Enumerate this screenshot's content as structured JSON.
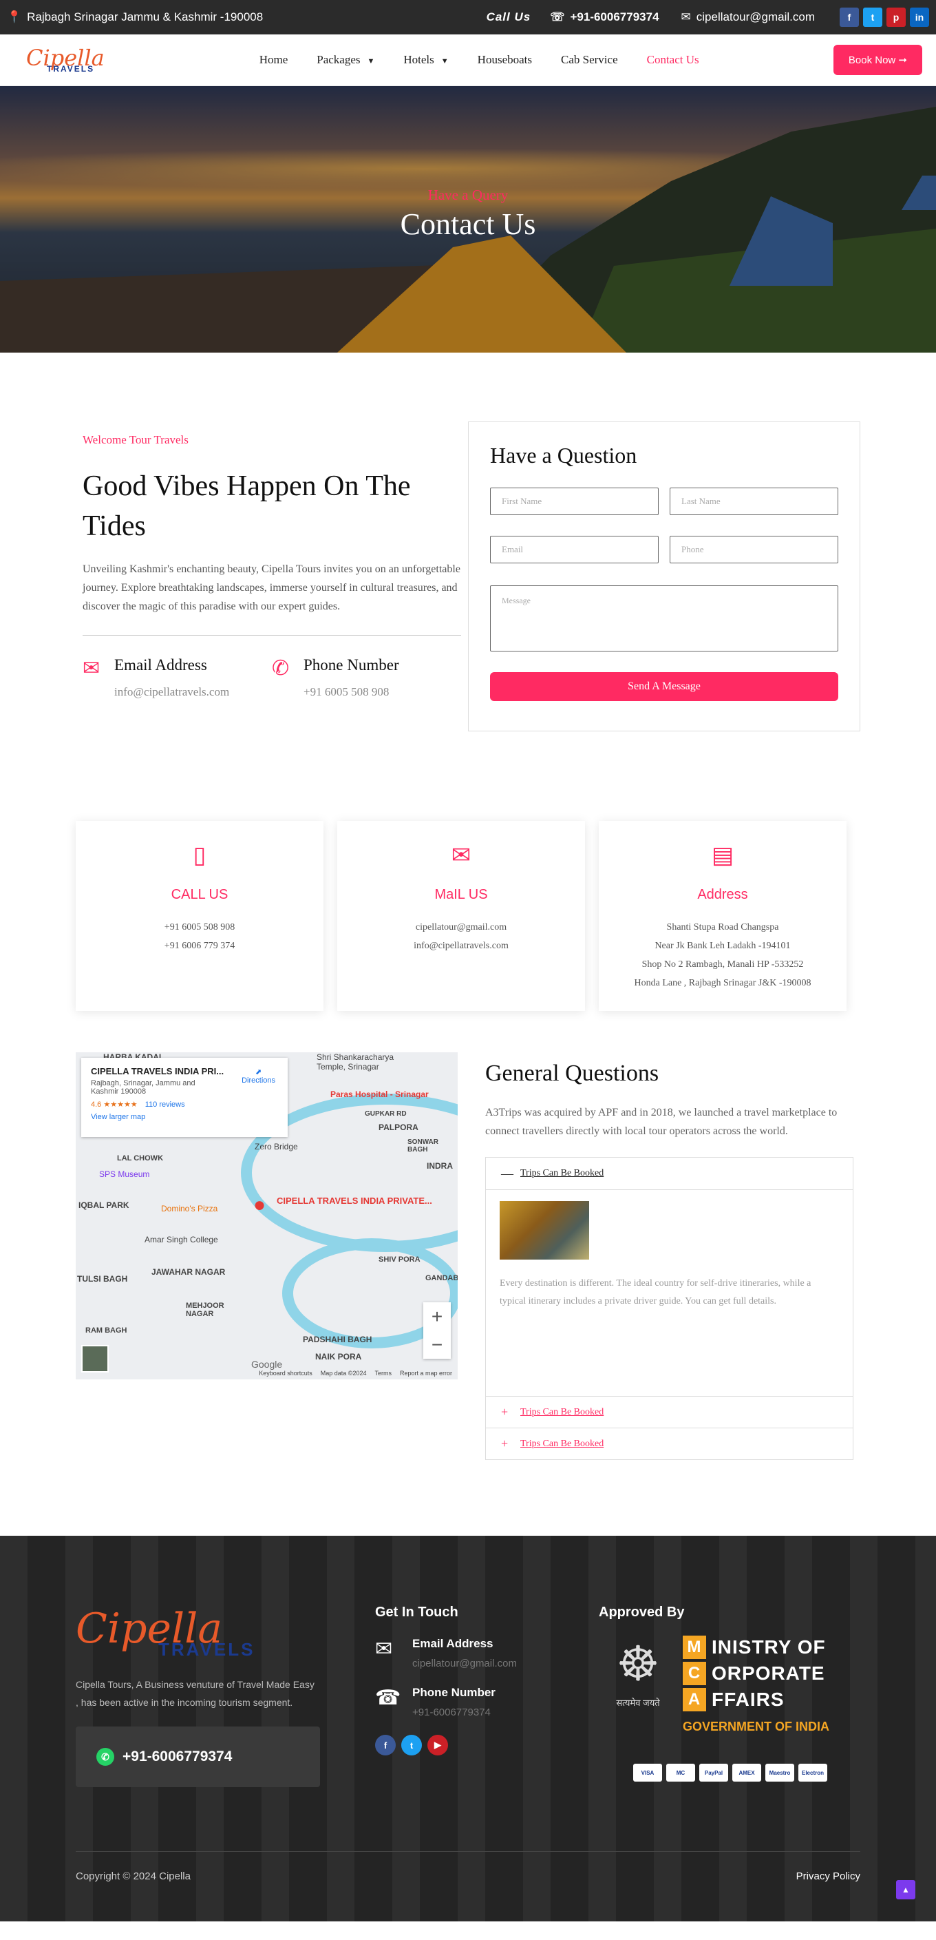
{
  "topbar": {
    "address": "Rajbagh Srinagar Jammu & Kashmir -190008",
    "call_label": "Call Us",
    "phone": "+91-6006779374",
    "email": "cipellatour@gmail.com"
  },
  "nav": {
    "logo_script": "Cipella",
    "logo_sub": "TRAVELS",
    "items": [
      "Home",
      "Packages",
      "Hotels",
      "Houseboats",
      "Cab Service",
      "Contact Us"
    ],
    "book_now": "Book Now ➞"
  },
  "hero": {
    "subtitle": "Have a Query",
    "title": "Contact Us"
  },
  "welcome": {
    "tag": "Welcome Tour Travels",
    "heading": "Good Vibes Happen On The Tides",
    "paragraph": "Unveiling Kashmir's enchanting beauty, Cipella Tours invites you on an unforgettable journey. Explore breathtaking landscapes, immerse yourself in cultural treasures, and discover the magic of this paradise with our expert guides.",
    "email_title": "Email Address",
    "email_value": "info@cipellatravels.com",
    "phone_title": "Phone Number",
    "phone_value": "+91 6005 508 908"
  },
  "form": {
    "title": "Have a Question",
    "first_name": "First Name",
    "last_name": "Last Name",
    "email": "Email",
    "phone": "Phone",
    "message": "Message",
    "submit": "Send A Message"
  },
  "cards": [
    {
      "title": "CALL US",
      "lines": [
        "+91 6005 508 908",
        "+91 6006 779 374"
      ]
    },
    {
      "title": "MaIL US",
      "lines": [
        "cipellatour@gmail.com",
        "info@cipellatravels.com"
      ]
    },
    {
      "title": "Address",
      "lines": [
        "Shanti Stupa Road Changspa",
        "Near Jk Bank Leh Ladakh -194101",
        "Shop No 2 Rambagh, Manali HP -533252",
        "Honda Lane , Rajbagh Srinagar J&K -190008"
      ]
    }
  ],
  "map": {
    "place_name": "CIPELLA TRAVELS INDIA PRI...",
    "place_address": "Rajbagh, Srinagar, Jammu and Kashmir 190008",
    "rating": "4.6",
    "stars": "★★★★★",
    "reviews": "110 reviews",
    "larger_map": "View larger map",
    "directions": "Directions",
    "labels": [
      "HARBA KADAL",
      "Shri Shankaracharya Temple, Srinagar",
      "Paras Hospital - Srinagar",
      "GUPKAR RD",
      "PALPORA",
      "SONWAR BAGH",
      "INDRA",
      "Zero Bridge",
      "SPS Museum",
      "LAL CHOWK",
      "IQBAL PARK",
      "Domino's Pizza",
      "Amar Singh College",
      "TULSI BAGH",
      "JAWAHAR NAGAR",
      "SHIV PORA",
      "GANDABAL",
      "MEHJOOR NAGAR",
      "RAM BAGH",
      "PADSHAHI BAGH",
      "NAIK PORA"
    ],
    "pin_label": "CIPELLA TRAVELS INDIA PRIVATE...",
    "google": "Google",
    "footer_items": [
      "Keyboard shortcuts",
      "Map data ©2024",
      "Terms",
      "Report a map error"
    ]
  },
  "faq": {
    "title": "General Questions",
    "intro": "A3Trips was acquired by APF and in 2018, we launched a travel marketplace to connect travellers directly with local tour operators across the world.",
    "items": [
      {
        "label": "Trips Can Be Booked",
        "symbol": "—",
        "body": "Every destination is different. The ideal country for self-drive itineraries, while a typical itinerary includes a private driver guide. You can get full details."
      },
      {
        "label": "Trips Can Be Booked",
        "symbol": "+"
      },
      {
        "label": "Trips Can Be Booked",
        "symbol": "+"
      }
    ]
  },
  "footer": {
    "logo_script": "Cipella",
    "logo_sub": "TRAVELS",
    "description": "Cipella Tours, A Business venuture of Travel Made Easy , has been active in the incoming tourism segment.",
    "whatsapp": "+91-6006779374",
    "get_in_touch": "Get In Touch",
    "email_title": "Email Address",
    "email_value": "cipellatour@gmail.com",
    "phone_title": "Phone Number",
    "phone_value": "+91-6006779374",
    "approved_by": "Approved By",
    "emblem_caption": "सत्यमेव जयते",
    "mca_lines": [
      {
        "letter": "M",
        "rest": "INISTRY OF"
      },
      {
        "letter": "C",
        "rest": "ORPORATE"
      },
      {
        "letter": "A",
        "rest": "FFAIRS"
      }
    ],
    "mca_gov": "GOVERNMENT OF INDIA",
    "payment_cards": [
      "VISA",
      "MC",
      "PayPal",
      "AMEX",
      "Maestro",
      "Electron"
    ],
    "copyright": "Copyright © 2024 Cipella",
    "privacy": "Privacy Policy"
  },
  "colors": {
    "accent": "#ff2a62",
    "topbar_bg": "#2b2b2b",
    "footer_bg": "#262626",
    "facebook": "#3b5998",
    "twitter": "#1da1f2",
    "pinterest": "#cb2027",
    "linkedin": "#0a66c2"
  }
}
